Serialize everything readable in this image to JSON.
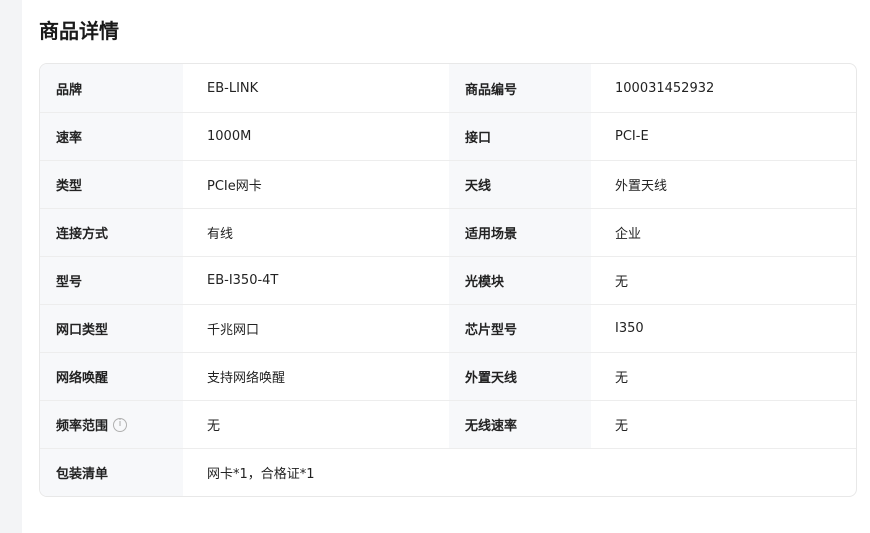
{
  "page": {
    "title": "商品详情"
  },
  "specs": [
    {
      "l1": "品牌",
      "v1": "EB-LINK",
      "l2": "商品编号",
      "v2": "100031452932"
    },
    {
      "l1": "速率",
      "v1": "1000M",
      "l2": "接口",
      "v2": "PCI-E"
    },
    {
      "l1": "类型",
      "v1": "PCIe网卡",
      "l2": "天线",
      "v2": "外置天线"
    },
    {
      "l1": "连接方式",
      "v1": "有线",
      "l2": "适用场景",
      "v2": "企业"
    },
    {
      "l1": "型号",
      "v1": "EB-I350-4T",
      "l2": "光模块",
      "v2": "无"
    },
    {
      "l1": "网口类型",
      "v1": "千兆网口",
      "l2": "芯片型号",
      "v2": "I350"
    },
    {
      "l1": "网络唤醒",
      "v1": "支持网络唤醒",
      "l2": "外置天线",
      "v2": "无"
    },
    {
      "l1": "频率范围",
      "v1": "无",
      "l2": "无线速率",
      "v2": "无"
    }
  ],
  "package": {
    "label": "包装清单",
    "value": "网卡*1，合格证*1"
  },
  "icons": {
    "info": "info-icon",
    "info_glyph": "i"
  }
}
